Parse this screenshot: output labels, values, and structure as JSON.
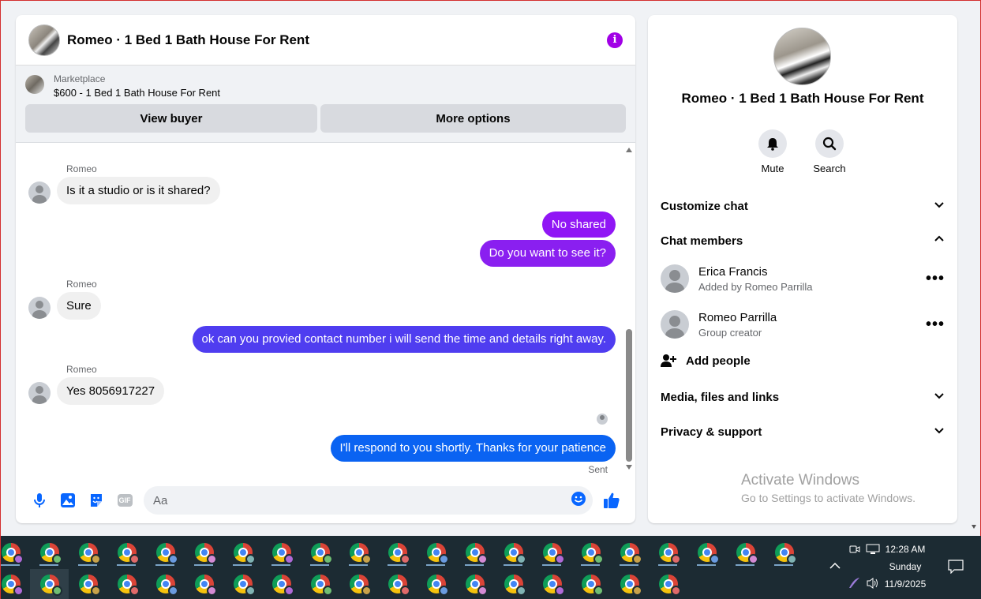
{
  "chat": {
    "title": "Romeo · 1 Bed 1 Bath House For Rent",
    "listing_source": "Marketplace",
    "listing_price": "$600 - 1 Bed 1 Bath House For Rent",
    "view_buyer": "View buyer",
    "more_options": "More options",
    "messages": [
      {
        "sender": "Romeo",
        "text": "Is it a studio or is it shared?",
        "direction": "in"
      },
      {
        "text": "No shared",
        "direction": "out",
        "color": "#9016f5"
      },
      {
        "text": "Do you want to see it?",
        "direction": "out",
        "color": "#8a1ff0"
      },
      {
        "sender": "Romeo",
        "text": "Sure",
        "direction": "in"
      },
      {
        "text": "ok can you provied contact number i will send the time and details right away.",
        "direction": "out",
        "color": "#4f3df0"
      },
      {
        "sender": "Romeo",
        "text": "Yes 8056917227",
        "direction": "in"
      },
      {
        "text": "I'll respond to you shortly. Thanks for your patience",
        "direction": "out",
        "color": "#0a63f2"
      }
    ],
    "sent_status": "Sent",
    "composer_placeholder": "Aa",
    "icon_names": [
      "microphone-icon",
      "image-icon",
      "sticker-icon",
      "gif-icon",
      "emoji-icon",
      "thumbs-up-icon"
    ],
    "gif_label": "GIF"
  },
  "info": {
    "title": "Romeo · 1 Bed 1 Bath House For Rent",
    "mute_label": "Mute",
    "search_label": "Search",
    "customize_chat": "Customize chat",
    "chat_members": "Chat members",
    "members": [
      {
        "name": "Erica Francis",
        "sub": "Added by Romeo Parrilla"
      },
      {
        "name": "Romeo Parrilla",
        "sub": "Group creator"
      }
    ],
    "add_people": "Add people",
    "media_files_links": "Media, files and links",
    "privacy_support": "Privacy & support"
  },
  "watermark": {
    "title": "Activate Windows",
    "subtitle": "Go to Settings to activate Windows."
  },
  "taskbar": {
    "time": "12:28 AM",
    "day": "Sunday",
    "date": "11/9/2025"
  },
  "colors": {
    "accent_purple": "#a100e6",
    "messenger_blue": "#0a63f2",
    "taskbar_bg": "#1c2b33"
  }
}
